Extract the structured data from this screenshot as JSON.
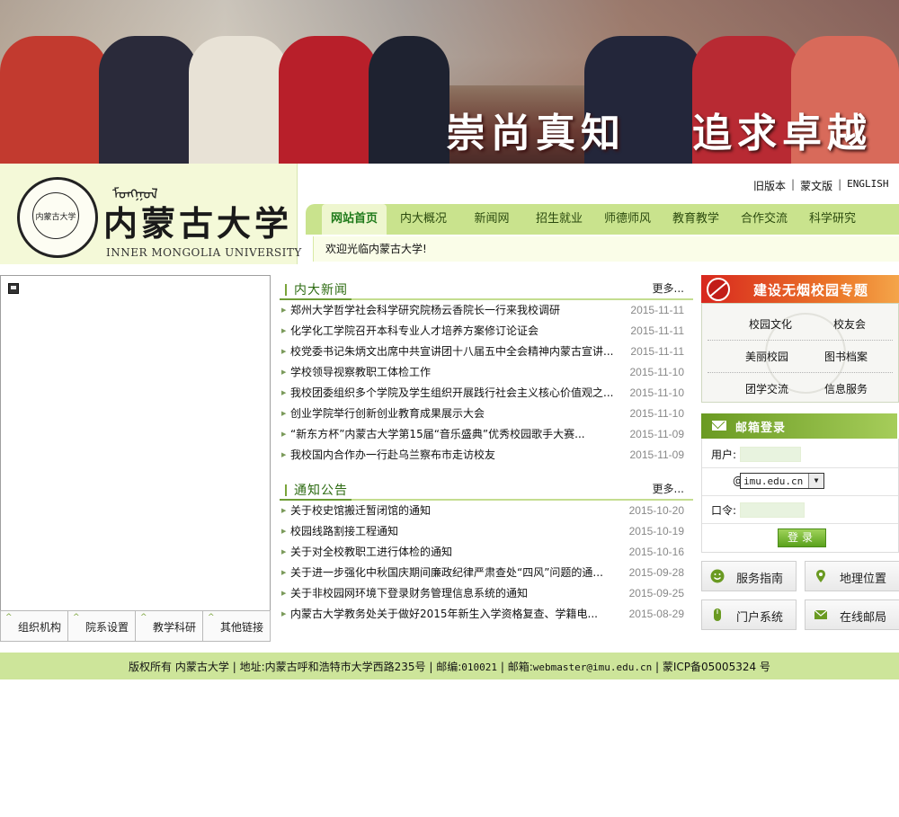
{
  "banner": {
    "slogan_left": "崇尚真知",
    "slogan_right": "追求卓越"
  },
  "logo": {
    "mongol_script": "ᠮᠣᠩᠭᠣᠯ",
    "cn_name": "内蒙古大学",
    "en_name": "INNER MONGOLIA UNIVERSITY",
    "seal_text": "内蒙古大学"
  },
  "toplinks": {
    "old": "旧版本",
    "mongolian": "蒙文版",
    "english": "ENGLISH"
  },
  "nav": {
    "items": [
      "网站首页",
      "内大概况",
      "新闻网",
      "招生就业",
      "师德师风",
      "教育教学",
      "合作交流",
      "科学研究"
    ]
  },
  "welcome": "欢迎光临内蒙古大学!",
  "left_tabs": [
    "组织机构",
    "院系设置",
    "教学科研",
    "其他链接"
  ],
  "news": {
    "title": "内大新闻",
    "more": "更多...",
    "items": [
      {
        "text": "郑州大学哲学社会科学研究院杨云香院长一行来我校调研",
        "date": "2015-11-11"
      },
      {
        "text": "化学化工学院召开本科专业人才培养方案修订论证会",
        "date": "2015-11-11"
      },
      {
        "text": "校党委书记朱炳文出席中共宣讲团十八届五中全会精神内蒙古宣讲...",
        "date": "2015-11-11"
      },
      {
        "text": "学校领导视察教职工体检工作",
        "date": "2015-11-10"
      },
      {
        "text": "我校团委组织多个学院及学生组织开展践行社会主义核心价值观之...",
        "date": "2015-11-10"
      },
      {
        "text": "创业学院举行创新创业教育成果展示大会",
        "date": "2015-11-10"
      },
      {
        "text": "“新东方杯”内蒙古大学第15届“音乐盛典”优秀校园歌手大赛...",
        "date": "2015-11-09"
      },
      {
        "text": "我校国内合作办一行赴乌兰察布市走访校友",
        "date": "2015-11-09"
      }
    ]
  },
  "notices": {
    "title": "通知公告",
    "more": "更多...",
    "items": [
      {
        "text": "关于校史馆搬迁暂闭馆的通知",
        "date": "2015-10-20"
      },
      {
        "text": "校园线路割接工程通知",
        "date": "2015-10-19"
      },
      {
        "text": "关于对全校教职工进行体检的通知",
        "date": "2015-10-16"
      },
      {
        "text": "关于进一步强化中秋国庆期间廉政纪律严肃查处“四风”问题的通...",
        "date": "2015-09-28"
      },
      {
        "text": "关于非校园网环境下登录财务管理信息系统的通知",
        "date": "2015-09-25"
      },
      {
        "text": "内蒙古大学教务处关于做好2015年新生入学资格复查、学籍电...",
        "date": "2015-08-29"
      }
    ]
  },
  "smokefree": {
    "label": "建设无烟校园专题"
  },
  "quick_links": [
    "校园文化",
    "校友会",
    "美丽校园",
    "图书档案",
    "团学交流",
    "信息服务"
  ],
  "mail": {
    "title": "邮箱登录",
    "user_label": "用户:",
    "at": "@",
    "domain": "imu.edu.cn",
    "password_label": "口令:",
    "login": "登录"
  },
  "services": [
    "服务指南",
    "地理位置",
    "门户系统",
    "在线邮局"
  ],
  "footer": {
    "copyright": "版权所有 内蒙古大学",
    "address": "地址:内蒙古呼和浩特市大学西路235号",
    "postcode_label": "邮编:",
    "postcode": "010021",
    "email_label": "邮箱:",
    "email": "webmaster@imu.edu.cn",
    "icp": "蒙ICP备05005324 号"
  },
  "colors": {
    "nav_green": "#c9e38d",
    "footer_green": "#cde59a",
    "title_green": "#2d6b12",
    "smoke_red": "#d8281e"
  }
}
